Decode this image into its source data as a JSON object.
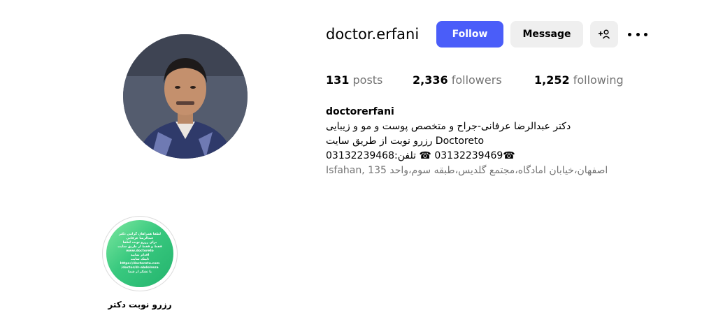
{
  "profile": {
    "username": "doctor.erfani",
    "avatar_icon": "profile-photo",
    "follow_label": "Follow",
    "message_label": "Message",
    "suggest_icon": "add-person-icon",
    "more_icon": "more-dots-icon"
  },
  "stats": {
    "posts_count": "131",
    "posts_label": "posts",
    "followers_count": "2,336",
    "followers_label": "followers",
    "following_count": "1,252",
    "following_label": "following"
  },
  "bio": {
    "name": "doctorerfani",
    "line1": "دکتر عبدالرضا عرفانی-جراح و متخصص پوست و مو و زیبایی",
    "line2": "Doctoreto رزرو نوبت از طریق سایت",
    "line3": "☎03132239469 ☎ تلفن:03132239468",
    "line4": "اصفهان،خیابان امادگاه،مجتمع گلدیس،طبقه سوم،واحد 135 ,Isfahan"
  },
  "highlights": [
    {
      "caption": "رزرو نوبت دکتر",
      "cover_lines": [
        "لطفا همراهان گرامی دکتر",
        "عبدالرضا عرفانی",
        "برای رزرو نوبت لطفا",
        "فقط و فقط از طریق سایت",
        "www.doctoreto",
        "اقدام نمایید",
        "لینک سایت:",
        "https://doctoreto.com",
        "/doctor/dr-abdolreza",
        "با تشکر از شما"
      ]
    }
  ],
  "colors": {
    "follow_bg": "#4a5df9",
    "secondary_bg": "#efefef",
    "muted_text": "#737373",
    "highlight_gradient": "#23b36d"
  }
}
